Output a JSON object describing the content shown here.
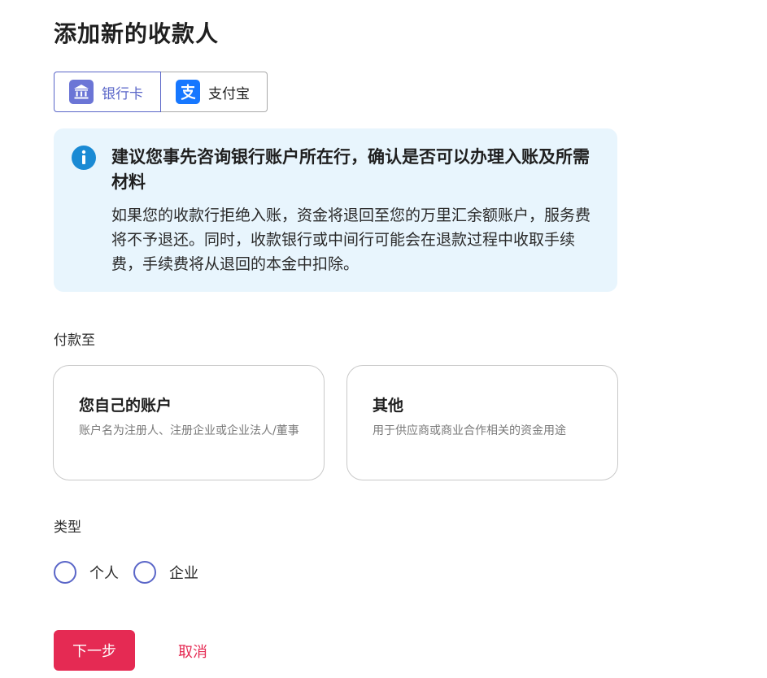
{
  "page": {
    "title": "添加新的收款人"
  },
  "methods": {
    "bank_label": "银行卡",
    "alipay_label": "支付宝",
    "active": "bank"
  },
  "notice": {
    "icon": "info-icon",
    "title": "建议您事先咨询银行账户所在行，确认是否可以办理入账及所需材料",
    "body": "如果您的收款行拒绝入账，资金将退回至您的万里汇余额账户，服务费将不予退还。同时，收款银行或中间行可能会在退款过程中收取手续费，手续费将从退回的本金中扣除。"
  },
  "pay_to": {
    "label": "付款至",
    "options": [
      {
        "title": "您自己的账户",
        "desc": "账户名为注册人、注册企业或企业法人/董事"
      },
      {
        "title": "其他",
        "desc": "用于供应商或商业合作相关的资金用途"
      }
    ]
  },
  "type": {
    "label": "类型",
    "options": [
      "个人",
      "企业"
    ]
  },
  "actions": {
    "next_label": "下一步",
    "cancel_label": "取消"
  },
  "colors": {
    "accent": "#5a66c8",
    "primary_button": "#e52a53",
    "notice_bg": "#e8f5fd",
    "info_icon": "#1a8ad4"
  }
}
